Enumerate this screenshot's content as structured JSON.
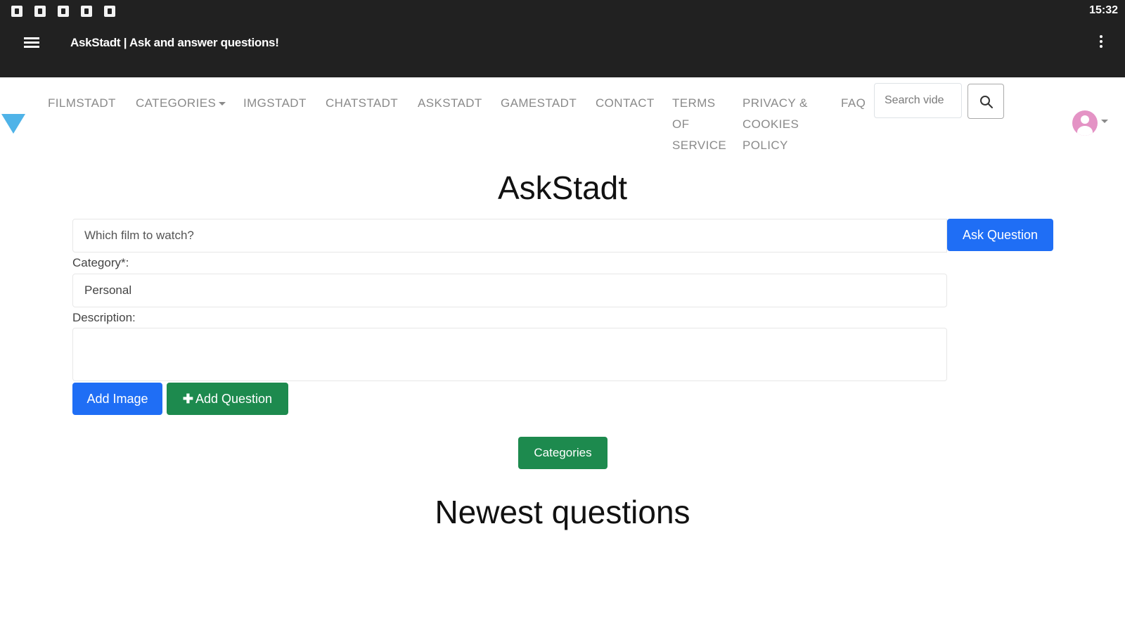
{
  "status_bar": {
    "icons": [
      "app-notification-icon",
      "app-notification-icon",
      "app-notification-icon",
      "android-debug-icon",
      "app-notification-icon"
    ],
    "time": "15:32"
  },
  "app_bar": {
    "title": "AskStadt | Ask and answer questions!",
    "menu_icon": "hamburger-menu-icon",
    "overflow_icon": "more-vert-icon"
  },
  "nav": {
    "logo_icon": "triangle-logo-icon",
    "links": [
      {
        "label": "FILMSTADT"
      },
      {
        "label": "CATEGORIES"
      },
      {
        "label": "IMGSTADT"
      },
      {
        "label": "CHATSTADT"
      },
      {
        "label": "ASKSTADT"
      },
      {
        "label": "GAMESTADT"
      },
      {
        "label": "CONTACT"
      },
      {
        "label": "TERMS OF SERVICE"
      },
      {
        "label": "PRIVACY & COOKIES POLICY"
      },
      {
        "label": "FAQ"
      }
    ],
    "search_placeholder": "Search vide",
    "search_icon": "search-icon",
    "avatar_icon": "user-avatar-icon"
  },
  "main": {
    "title": "AskStadt",
    "question_placeholder": "Which film to watch?",
    "ask_button": "Ask Question",
    "category_label": "Category*:",
    "category_value": "Personal",
    "description_label": "Description:",
    "add_image_button": "Add Image",
    "add_question_button": "Add Question",
    "categories_button": "Categories",
    "newest_title": "Newest questions"
  },
  "colors": {
    "app_bar": "#212121",
    "primary_blue": "#1f6ef5",
    "success_green": "#1d8a4e",
    "logo_blue": "#4fb3e8",
    "avatar_pink": "#e493c5"
  }
}
